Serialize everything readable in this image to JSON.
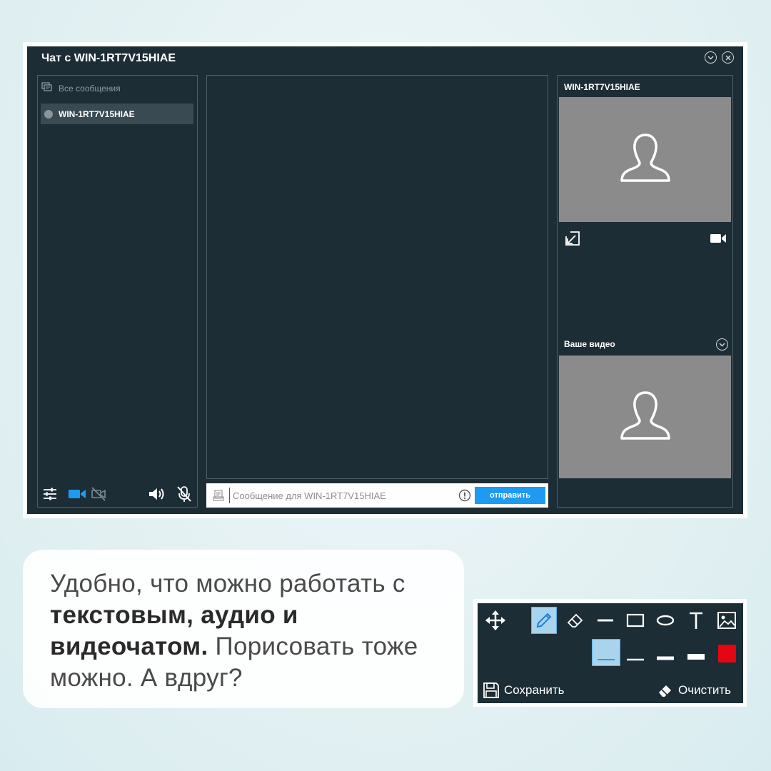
{
  "window": {
    "title": "Чат с WIN-1RT7V15HIAE",
    "controls": [
      "chevron-down-icon",
      "close-icon"
    ]
  },
  "sidebar": {
    "all_messages_label": "Все сообщения",
    "contacts": [
      {
        "name": "WIN-1RT7V15HIAE",
        "status": "offline"
      }
    ],
    "bottom_icons": [
      "settings-sliders-icon",
      "camera-icon",
      "camera-off-icon",
      "speaker-icon",
      "mic-off-icon"
    ]
  },
  "composer": {
    "placeholder": "Сообщение для WIN-1RT7V15HIAE",
    "send_label": "отправить"
  },
  "video": {
    "peer_name": "WIN-1RT7V15HIAE",
    "your_video_label": "Ваше видео"
  },
  "caption": {
    "part1": "Удобно, что можно работать с ",
    "bold1": "текстовым, аудио и видеочатом.",
    "part2": " Порисовать тоже можно. А вдруг?"
  },
  "toolbar": {
    "tools": [
      "move-icon",
      "pencil-icon",
      "eraser-icon",
      "line-icon",
      "rectangle-icon",
      "ellipse-icon",
      "text-icon",
      "image-icon"
    ],
    "active_tool": "pencil-icon",
    "save_label": "Сохранить",
    "clear_label": "Очистить",
    "stroke_color": "#e30613",
    "accent": "#1e9bf0"
  }
}
